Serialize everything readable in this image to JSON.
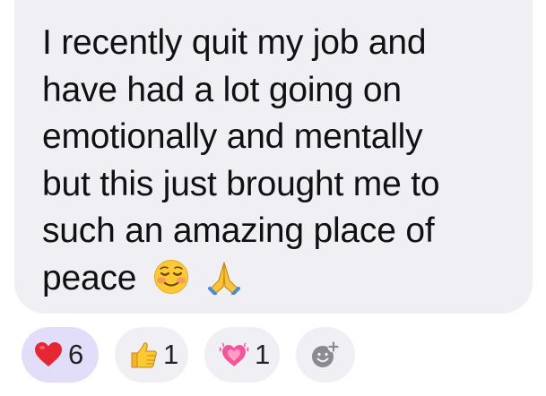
{
  "message": {
    "lines": [
      "I recently quit my job and",
      "have had a lot going on",
      "emotionally and mentally",
      "but this just brought me to",
      "such an amazing place of",
      "peace"
    ],
    "emojis": [
      "smiling-face-icon",
      "folded-hands-icon"
    ]
  },
  "reactions": [
    {
      "icon": "red-heart-icon",
      "count": "6",
      "selected": true
    },
    {
      "icon": "thumbs-up-icon",
      "count": "1",
      "selected": false
    },
    {
      "icon": "pink-hearts-icon",
      "count": "1",
      "selected": false
    }
  ],
  "add_reaction": {
    "icon": "add-reaction-icon"
  },
  "colors": {
    "bubble": "#efeff4",
    "selected_pill": "#e2def9",
    "text": "#111111"
  }
}
